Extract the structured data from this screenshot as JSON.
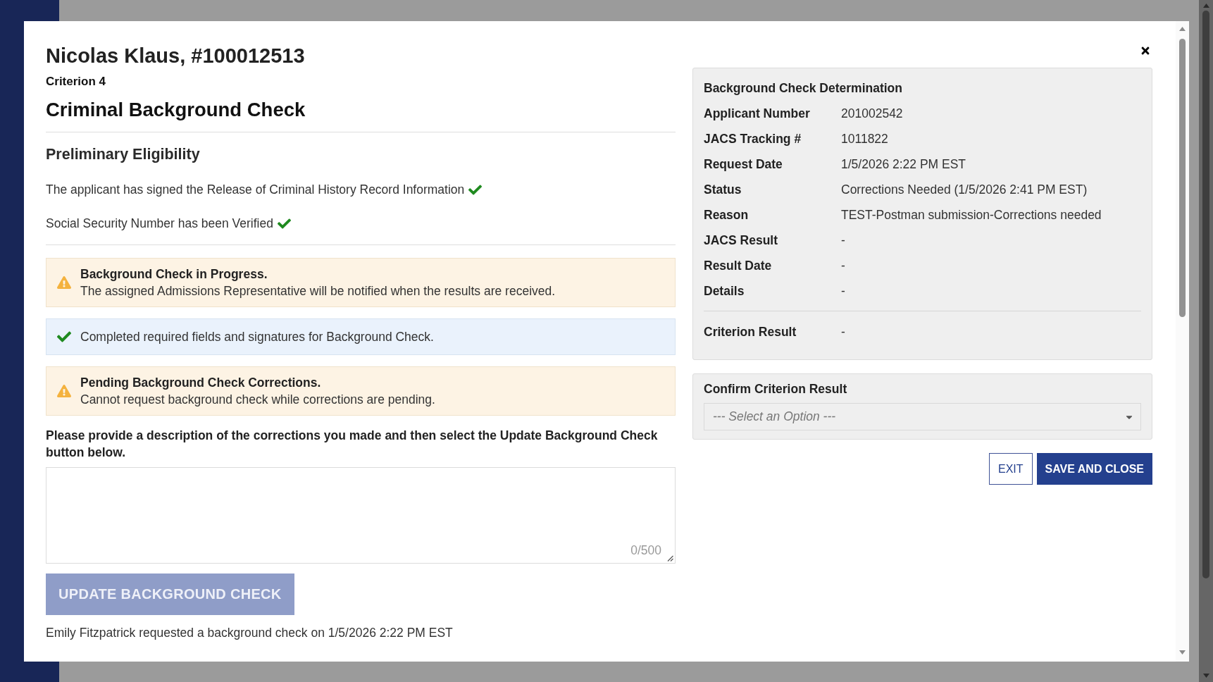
{
  "dialog": {
    "title": "Nicolas Klaus, #100012513",
    "criterion": "Criterion 4",
    "heading": "Criminal Background Check",
    "preliminary": {
      "title": "Preliminary Eligibility",
      "items": [
        {
          "text": "The applicant has signed the Release of Criminal History Record Information",
          "checked": true
        },
        {
          "text": "Social Security Number has been Verified",
          "checked": true
        }
      ]
    },
    "alerts": [
      {
        "kind": "warning",
        "title": "Background Check in Progress.",
        "text": "The assigned Admissions Representative will be notified when the results are received."
      },
      {
        "kind": "success",
        "text": "Completed required fields and signatures for Background Check."
      },
      {
        "kind": "warning",
        "title": "Pending Background Check Corrections.",
        "text": "Cannot request background check while corrections are pending."
      }
    ],
    "corrections": {
      "instruction": "Please provide a description of the corrections you made and then select the Update Background Check button below.",
      "counter": "0/500"
    },
    "update_button": {
      "label": "UPDATE BACKGROUND CHECK",
      "disabled": true
    },
    "request_note": "Emily Fitzpatrick requested a background check on 1/5/2026 2:22 PM EST",
    "determination": {
      "title": "Background Check Determination",
      "rows": [
        {
          "label": "Applicant Number",
          "value": "201002542"
        },
        {
          "label": "JACS Tracking #",
          "value": "1011822"
        },
        {
          "label": "Request Date",
          "value": "1/5/2026 2:22 PM EST"
        },
        {
          "label": "Status",
          "value": "Corrections Needed (1/5/2026 2:41 PM EST)"
        },
        {
          "label": "Reason",
          "value": "TEST-Postman submission-Corrections needed"
        },
        {
          "label": "JACS Result",
          "value": "-"
        },
        {
          "label": "Result Date",
          "value": "-"
        },
        {
          "label": "Details",
          "value": "-"
        }
      ],
      "result": {
        "label": "Criterion Result",
        "value": "-"
      }
    },
    "confirm": {
      "title": "Confirm Criterion Result",
      "select": {
        "placeholder": "--- Select an Option ---"
      }
    },
    "buttons": [
      {
        "kind": "secondary",
        "label": "EXIT"
      },
      {
        "kind": "primary",
        "label": "SAVE AND CLOSE"
      }
    ]
  }
}
